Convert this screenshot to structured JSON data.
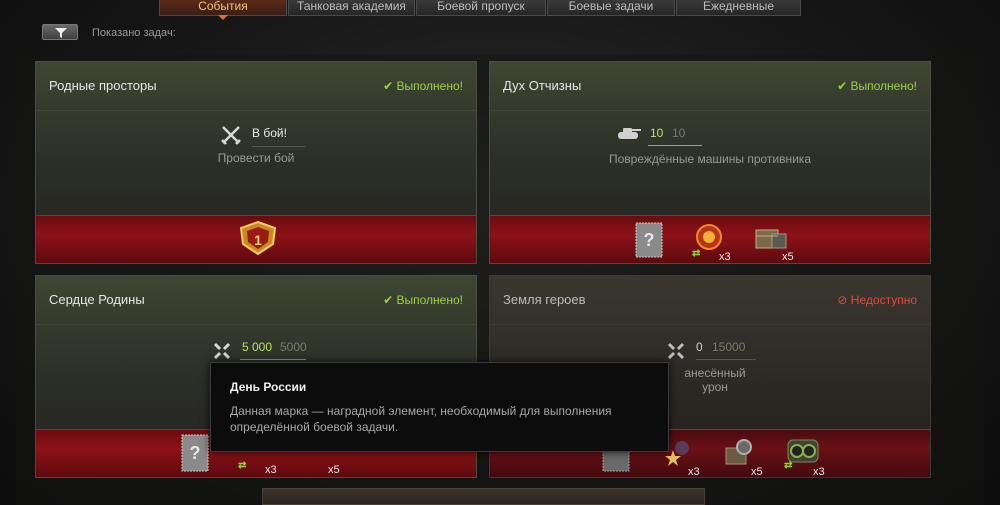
{
  "tabs": [
    {
      "label": "События",
      "active": true
    },
    {
      "label": "Танковая академия",
      "active": false
    },
    {
      "label": "Боевой пропуск",
      "active": false
    },
    {
      "label": "Боевые задачи",
      "active": false
    },
    {
      "label": "Ежедневные",
      "active": false
    }
  ],
  "toolbar": {
    "shown_label": "Показано задач:"
  },
  "cards": [
    {
      "title": "Родные просторы",
      "status": "✔ Выполнено!",
      "condition_main": "В бой!",
      "condition_desc": "Провести бой",
      "rewards": [
        {
          "icon": "rank-medal-icon",
          "text": "1"
        }
      ]
    },
    {
      "title": "Дух Отчизны",
      "status": "✔ Выполнено!",
      "condition_value": "10",
      "condition_goal": "10",
      "condition_desc": "Повреждённые машины противника",
      "rewards": [
        {
          "icon": "stamp-icon",
          "qty": ""
        },
        {
          "icon": "booster-icon",
          "qty": "x3"
        },
        {
          "icon": "crate-icon",
          "qty": "x5"
        }
      ]
    },
    {
      "title": "Сердце Родины",
      "status": "✔ Выполнено!",
      "condition_value": "5 000",
      "condition_goal": "5000",
      "rewards": [
        {
          "icon": "stamp-icon",
          "qty": ""
        },
        {
          "icon": "booster-icon",
          "qty": "x3"
        },
        {
          "icon": "crew-icon",
          "qty": "x5"
        }
      ]
    },
    {
      "title": "Земля героев",
      "status": "⊘ Недоступно",
      "condition_value": "0",
      "condition_goal": "15000",
      "condition_desc": "анесённый урон",
      "rewards": [
        {
          "icon": "stamp-icon",
          "qty": ""
        },
        {
          "icon": "star-crew-icon",
          "qty": "x3"
        },
        {
          "icon": "crate-gear-icon",
          "qty": "x5"
        },
        {
          "icon": "binoculars-icon",
          "qty": "x3"
        }
      ]
    }
  ],
  "tooltip": {
    "title": "День России",
    "text": "Данная марка — наградной элемент, необходимый для выполнения определённой боевой задачи."
  },
  "colors": {
    "accent_green": "#9ad148",
    "status_red": "#e04b3a",
    "reward_red": "#8c1218",
    "active_tab": "#f2c37a"
  }
}
